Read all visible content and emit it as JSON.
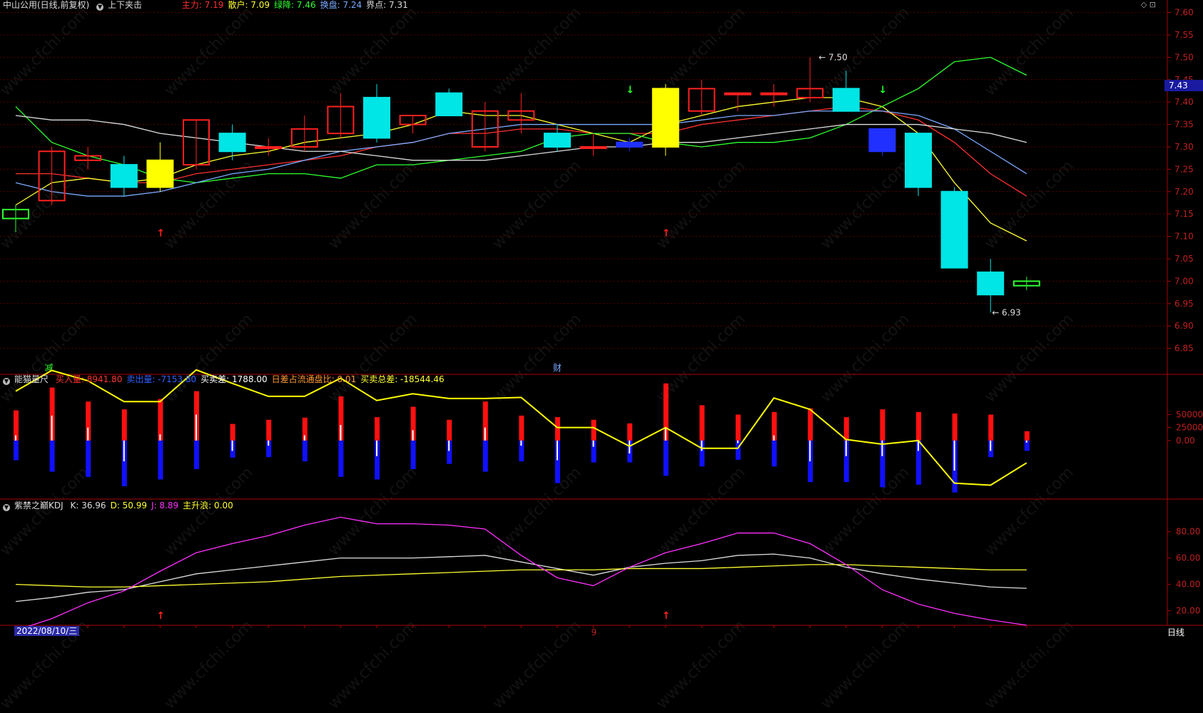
{
  "main_panel": {
    "title": "中山公用(日线,前复权)",
    "indicator_name": "上下夹击",
    "legend": [
      {
        "label": "主力:",
        "value": "7.19",
        "color": "#ff3030"
      },
      {
        "label": "散户:",
        "value": "7.09",
        "color": "#ffff30"
      },
      {
        "label": "绿降:",
        "value": "7.46",
        "color": "#30ff30"
      },
      {
        "label": "换盘:",
        "value": "7.24",
        "color": "#7aaaff"
      },
      {
        "label": "界点:",
        "value": "7.31",
        "color": "#dddddd"
      }
    ],
    "high_label": "7.50",
    "low_label": "6.93",
    "current_price": "7.43",
    "marker_reduce": "减",
    "marker_finance": "财",
    "y_ticks": [
      "7.60",
      "7.55",
      "7.50",
      "7.45",
      "7.40",
      "7.35",
      "7.30",
      "7.25",
      "7.20",
      "7.15",
      "7.10",
      "7.05",
      "7.00",
      "6.95",
      "6.90",
      "6.85"
    ]
  },
  "volume_panel": {
    "title": "能猫量尺",
    "legend": [
      {
        "label": "买入量:",
        "value": "8941.80",
        "color": "#ff3030"
      },
      {
        "label": "卖出量:",
        "value": "-7153.80",
        "color": "#3060ff"
      },
      {
        "label": "买卖差:",
        "value": "1788.00",
        "color": "#ffffff"
      },
      {
        "label": "日差占流通盘比:",
        "value": "0.01",
        "color": "#ff9a30"
      },
      {
        "label": "买卖总差:",
        "value": "-18544.46",
        "color": "#ffff30"
      }
    ],
    "y_ticks": [
      "50000",
      "25000",
      "0.00"
    ]
  },
  "kdj_panel": {
    "title": "紫禁之巅KDJ",
    "legend": [
      {
        "label": "K:",
        "value": "36.96",
        "color": "#dddddd"
      },
      {
        "label": "D:",
        "value": "50.99",
        "color": "#ffff30"
      },
      {
        "label": "J:",
        "value": "8.89",
        "color": "#ff30ff"
      },
      {
        "label": "主升浪:",
        "value": "0.00",
        "color": "#ffff30"
      }
    ],
    "y_ticks": [
      "80.00",
      "60.00",
      "40.00",
      "20.00"
    ]
  },
  "footer": {
    "date": "2022/08/10/三",
    "month_marker": "9",
    "period": "日线"
  },
  "watermark": "www.cfchi.com",
  "colors": {
    "up": "#ff2020",
    "down_cyan": "#00e5e5",
    "yellow": "#ffff00",
    "blue": "#2030ff",
    "grid": "#5a0000",
    "axis": "#b00000"
  },
  "chart_data": [
    {
      "type": "candlestick",
      "title": "中山公用(日线,前复权)",
      "ylim": [
        6.8,
        7.62
      ],
      "candles": [
        {
          "o": 7.14,
          "h": 7.17,
          "l": 7.11,
          "c": 7.16
        },
        {
          "o": 7.18,
          "h": 7.3,
          "l": 7.17,
          "c": 7.29
        },
        {
          "o": 7.27,
          "h": 7.3,
          "l": 7.25,
          "c": 7.28
        },
        {
          "o": 7.26,
          "h": 7.28,
          "l": 7.19,
          "c": 7.21
        },
        {
          "o": 7.21,
          "h": 7.31,
          "l": 7.2,
          "c": 7.27
        },
        {
          "o": 7.26,
          "h": 7.36,
          "l": 7.25,
          "c": 7.36
        },
        {
          "o": 7.33,
          "h": 7.35,
          "l": 7.27,
          "c": 7.29
        },
        {
          "o": 7.3,
          "h": 7.32,
          "l": 7.28,
          "c": 7.3
        },
        {
          "o": 7.3,
          "h": 7.37,
          "l": 7.29,
          "c": 7.34
        },
        {
          "o": 7.33,
          "h": 7.42,
          "l": 7.32,
          "c": 7.39
        },
        {
          "o": 7.41,
          "h": 7.44,
          "l": 7.31,
          "c": 7.32
        },
        {
          "o": 7.35,
          "h": 7.37,
          "l": 7.33,
          "c": 7.37
        },
        {
          "o": 7.42,
          "h": 7.43,
          "l": 7.37,
          "c": 7.37
        },
        {
          "o": 7.3,
          "h": 7.4,
          "l": 7.29,
          "c": 7.38
        },
        {
          "o": 7.36,
          "h": 7.42,
          "l": 7.33,
          "c": 7.38
        },
        {
          "o": 7.33,
          "h": 7.35,
          "l": 7.29,
          "c": 7.3
        },
        {
          "o": 7.3,
          "h": 7.33,
          "l": 7.28,
          "c": 7.3
        },
        {
          "o": 7.31,
          "h": 7.32,
          "l": 7.29,
          "c": 7.3
        },
        {
          "o": 7.3,
          "h": 7.44,
          "l": 7.28,
          "c": 7.43
        },
        {
          "o": 7.38,
          "h": 7.45,
          "l": 7.37,
          "c": 7.43
        },
        {
          "o": 7.42,
          "h": 7.42,
          "l": 7.38,
          "c": 7.42
        },
        {
          "o": 7.42,
          "h": 7.44,
          "l": 7.39,
          "c": 7.42
        },
        {
          "o": 7.41,
          "h": 7.5,
          "l": 7.4,
          "c": 7.43
        },
        {
          "o": 7.43,
          "h": 7.47,
          "l": 7.38,
          "c": 7.38
        },
        {
          "o": 7.34,
          "h": 7.34,
          "l": 7.28,
          "c": 7.29
        },
        {
          "o": 7.33,
          "h": 7.33,
          "l": 7.19,
          "c": 7.21
        },
        {
          "o": 7.2,
          "h": 7.21,
          "l": 7.03,
          "c": 7.03
        },
        {
          "o": 7.02,
          "h": 7.05,
          "l": 6.93,
          "c": 6.97
        },
        {
          "o": 6.99,
          "h": 7.01,
          "l": 6.98,
          "c": 7.0
        }
      ],
      "series": [
        {
          "name": "主力",
          "color": "#ff3030",
          "values": [
            7.24,
            7.24,
            7.23,
            7.22,
            7.22,
            7.24,
            7.25,
            7.26,
            7.27,
            7.28,
            7.3,
            7.31,
            7.33,
            7.33,
            7.34,
            7.34,
            7.33,
            7.33,
            7.33,
            7.35,
            7.36,
            7.37,
            7.38,
            7.39,
            7.38,
            7.36,
            7.31,
            7.24,
            7.19
          ]
        },
        {
          "name": "散户",
          "color": "#ffff30",
          "values": [
            7.17,
            7.22,
            7.23,
            7.22,
            7.23,
            7.26,
            7.28,
            7.29,
            7.31,
            7.32,
            7.33,
            7.35,
            7.38,
            7.37,
            7.37,
            7.35,
            7.33,
            7.31,
            7.35,
            7.37,
            7.39,
            7.4,
            7.41,
            7.41,
            7.39,
            7.33,
            7.22,
            7.13,
            7.09
          ]
        },
        {
          "name": "绿降",
          "color": "#30ff30",
          "values": [
            7.39,
            7.31,
            7.28,
            7.26,
            7.23,
            7.22,
            7.23,
            7.24,
            7.24,
            7.23,
            7.26,
            7.26,
            7.27,
            7.28,
            7.29,
            7.32,
            7.33,
            7.33,
            7.31,
            7.3,
            7.31,
            7.31,
            7.32,
            7.35,
            7.39,
            7.43,
            7.49,
            7.5,
            7.46
          ]
        },
        {
          "name": "换盘",
          "color": "#7aaaff",
          "values": [
            7.22,
            7.2,
            7.19,
            7.19,
            7.2,
            7.22,
            7.24,
            7.25,
            7.27,
            7.29,
            7.3,
            7.31,
            7.33,
            7.34,
            7.35,
            7.35,
            7.35,
            7.35,
            7.35,
            7.36,
            7.37,
            7.37,
            7.38,
            7.38,
            7.38,
            7.37,
            7.34,
            7.29,
            7.24
          ]
        },
        {
          "name": "界点",
          "color": "#dddddd",
          "values": [
            7.37,
            7.36,
            7.36,
            7.35,
            7.33,
            7.32,
            7.31,
            7.3,
            7.29,
            7.29,
            7.28,
            7.27,
            7.27,
            7.27,
            7.28,
            7.29,
            7.3,
            7.3,
            7.31,
            7.31,
            7.32,
            7.33,
            7.34,
            7.35,
            7.35,
            7.35,
            7.34,
            7.33,
            7.31
          ]
        }
      ],
      "arrows_up_at": [
        4,
        18
      ],
      "arrows_down_at": [
        17,
        24
      ],
      "box_tops": [
        7.43,
        7.42,
        7.42,
        7.42,
        7.43,
        7.43
      ]
    },
    {
      "type": "bar",
      "title": "能猫量尺",
      "ylim": [
        -110000,
        100000
      ],
      "buy": [
        58000,
        102000,
        75000,
        60000,
        80000,
        95000,
        32000,
        40000,
        44000,
        85000,
        45000,
        65000,
        40000,
        75000,
        48000,
        45000,
        40000,
        33000,
        110000,
        68000,
        50000,
        55000,
        62000,
        45000,
        60000,
        55000,
        52000,
        50000,
        18000
      ],
      "sell": [
        -38000,
        -60000,
        -70000,
        -88000,
        -75000,
        -55000,
        -33000,
        -32000,
        -40000,
        -70000,
        -75000,
        -55000,
        -45000,
        -60000,
        -40000,
        -82000,
        -42000,
        -42000,
        -68000,
        -50000,
        -37000,
        -50000,
        -80000,
        -80000,
        -90000,
        -85000,
        -100000,
        -32000,
        -20000
      ],
      "net": [
        10000,
        48000,
        25000,
        -40000,
        12000,
        50000,
        -20000,
        -10000,
        10000,
        30000,
        -30000,
        20000,
        -20000,
        25000,
        -10000,
        -38000,
        -12000,
        -25000,
        25000,
        -20000,
        -5000,
        10000,
        -40000,
        -30000,
        -30000,
        -20000,
        -58000,
        -20000,
        -4000
      ],
      "total": [
        95000,
        135000,
        115000,
        75000,
        75000,
        136000,
        110000,
        85000,
        85000,
        120000,
        77000,
        90000,
        81000,
        81000,
        83000,
        25000,
        25000,
        -11000,
        25000,
        -15000,
        -15000,
        82000,
        60000,
        2000,
        -7000,
        0,
        -82000,
        -86000,
        -43000
      ]
    },
    {
      "type": "line",
      "title": "紫禁之巅KDJ",
      "ylim": [
        10,
        95
      ],
      "series": [
        {
          "name": "K",
          "color": "#dddddd",
          "values": [
            27,
            30,
            34,
            36,
            42,
            48,
            51,
            54,
            57,
            60,
            60,
            60,
            61,
            62,
            57,
            52,
            47,
            53,
            56,
            58,
            62,
            63,
            60,
            53,
            48,
            44,
            41,
            38,
            37
          ]
        },
        {
          "name": "D",
          "color": "#ffff30",
          "values": [
            40,
            39,
            38,
            38,
            39,
            40,
            41,
            42,
            44,
            46,
            47,
            48,
            49,
            50,
            51,
            51,
            51,
            52,
            52,
            52,
            53,
            54,
            55,
            55,
            54,
            53,
            52,
            51,
            51
          ]
        },
        {
          "name": "J",
          "color": "#ff30ff",
          "values": [
            5,
            14,
            26,
            35,
            50,
            64,
            71,
            77,
            85,
            91,
            86,
            86,
            85,
            82,
            62,
            45,
            39,
            53,
            64,
            71,
            79,
            79,
            71,
            55,
            36,
            25,
            18,
            13,
            9
          ]
        }
      ]
    }
  ]
}
